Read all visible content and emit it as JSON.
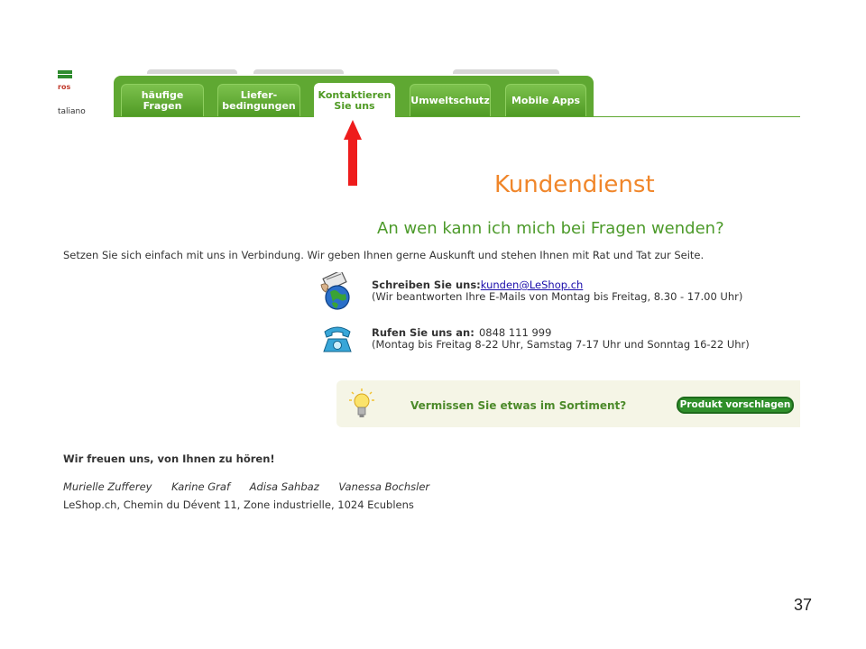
{
  "header": {
    "logo_text": "ros",
    "language": "taliano",
    "tabs": [
      {
        "label": "häufige Fragen",
        "active": false
      },
      {
        "label": "Liefer-\nbedingungen",
        "active": false
      },
      {
        "label": "Kontaktieren\nSie uns",
        "active": true
      },
      {
        "label": "Umweltschutz",
        "active": false
      },
      {
        "label": "Mobile Apps",
        "active": false
      }
    ]
  },
  "content": {
    "title": "Kundendienst",
    "subtitle": "An wen kann ich mich bei Fragen wenden?",
    "intro": "Setzen Sie sich einfach mit uns in Verbindung. Wir geben Ihnen gerne Auskunft und stehen Ihnen mit Rat und Tat zur Seite.",
    "email": {
      "label": "Schreiben Sie uns:",
      "value": "kunden@LeShop.ch",
      "note": "(Wir beantworten Ihre E-Mails von Montag bis Freitag, 8.30 - 17.00 Uhr)"
    },
    "phone": {
      "label": "Rufen Sie uns an:",
      "value": "0848 111 999",
      "note": "(Montag bis Freitag 8-22 Uhr, Samstag 7-17 Uhr und Sonntag 16-22 Uhr)"
    },
    "suggest": {
      "text": "Vermissen Sie etwas im Sortiment?",
      "button": "Produkt vorschlagen"
    },
    "thanks": "Wir freuen uns, von Ihnen zu hören!",
    "names": [
      "Murielle Zufferey",
      "Karine Graf",
      "Adisa Sahbaz",
      "Vanessa Bochsler"
    ],
    "address": "LeShop.ch, Chemin du Dévent 11, Zone industrielle, 1024 Ecublens"
  },
  "slide": {
    "page_number": "37"
  },
  "colors": {
    "tab_green": "#5fa832",
    "title_orange": "#f0862a",
    "subtitle_green": "#4c9a2a",
    "arrow_red": "#ee1c1c"
  }
}
